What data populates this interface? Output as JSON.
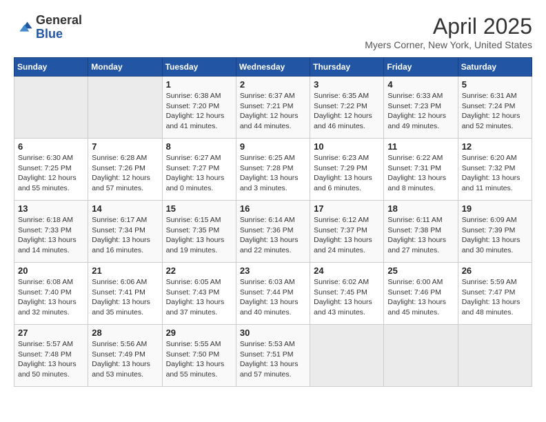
{
  "header": {
    "logo_general": "General",
    "logo_blue": "Blue",
    "month_title": "April 2025",
    "location": "Myers Corner, New York, United States"
  },
  "weekdays": [
    "Sunday",
    "Monday",
    "Tuesday",
    "Wednesday",
    "Thursday",
    "Friday",
    "Saturday"
  ],
  "weeks": [
    [
      {
        "day": "",
        "info": ""
      },
      {
        "day": "",
        "info": ""
      },
      {
        "day": "1",
        "sunrise": "6:38 AM",
        "sunset": "7:20 PM",
        "daylight": "12 hours and 41 minutes."
      },
      {
        "day": "2",
        "sunrise": "6:37 AM",
        "sunset": "7:21 PM",
        "daylight": "12 hours and 44 minutes."
      },
      {
        "day": "3",
        "sunrise": "6:35 AM",
        "sunset": "7:22 PM",
        "daylight": "12 hours and 46 minutes."
      },
      {
        "day": "4",
        "sunrise": "6:33 AM",
        "sunset": "7:23 PM",
        "daylight": "12 hours and 49 minutes."
      },
      {
        "day": "5",
        "sunrise": "6:31 AM",
        "sunset": "7:24 PM",
        "daylight": "12 hours and 52 minutes."
      }
    ],
    [
      {
        "day": "6",
        "sunrise": "6:30 AM",
        "sunset": "7:25 PM",
        "daylight": "12 hours and 55 minutes."
      },
      {
        "day": "7",
        "sunrise": "6:28 AM",
        "sunset": "7:26 PM",
        "daylight": "12 hours and 57 minutes."
      },
      {
        "day": "8",
        "sunrise": "6:27 AM",
        "sunset": "7:27 PM",
        "daylight": "13 hours and 0 minutes."
      },
      {
        "day": "9",
        "sunrise": "6:25 AM",
        "sunset": "7:28 PM",
        "daylight": "13 hours and 3 minutes."
      },
      {
        "day": "10",
        "sunrise": "6:23 AM",
        "sunset": "7:29 PM",
        "daylight": "13 hours and 6 minutes."
      },
      {
        "day": "11",
        "sunrise": "6:22 AM",
        "sunset": "7:31 PM",
        "daylight": "13 hours and 8 minutes."
      },
      {
        "day": "12",
        "sunrise": "6:20 AM",
        "sunset": "7:32 PM",
        "daylight": "13 hours and 11 minutes."
      }
    ],
    [
      {
        "day": "13",
        "sunrise": "6:18 AM",
        "sunset": "7:33 PM",
        "daylight": "13 hours and 14 minutes."
      },
      {
        "day": "14",
        "sunrise": "6:17 AM",
        "sunset": "7:34 PM",
        "daylight": "13 hours and 16 minutes."
      },
      {
        "day": "15",
        "sunrise": "6:15 AM",
        "sunset": "7:35 PM",
        "daylight": "13 hours and 19 minutes."
      },
      {
        "day": "16",
        "sunrise": "6:14 AM",
        "sunset": "7:36 PM",
        "daylight": "13 hours and 22 minutes."
      },
      {
        "day": "17",
        "sunrise": "6:12 AM",
        "sunset": "7:37 PM",
        "daylight": "13 hours and 24 minutes."
      },
      {
        "day": "18",
        "sunrise": "6:11 AM",
        "sunset": "7:38 PM",
        "daylight": "13 hours and 27 minutes."
      },
      {
        "day": "19",
        "sunrise": "6:09 AM",
        "sunset": "7:39 PM",
        "daylight": "13 hours and 30 minutes."
      }
    ],
    [
      {
        "day": "20",
        "sunrise": "6:08 AM",
        "sunset": "7:40 PM",
        "daylight": "13 hours and 32 minutes."
      },
      {
        "day": "21",
        "sunrise": "6:06 AM",
        "sunset": "7:41 PM",
        "daylight": "13 hours and 35 minutes."
      },
      {
        "day": "22",
        "sunrise": "6:05 AM",
        "sunset": "7:43 PM",
        "daylight": "13 hours and 37 minutes."
      },
      {
        "day": "23",
        "sunrise": "6:03 AM",
        "sunset": "7:44 PM",
        "daylight": "13 hours and 40 minutes."
      },
      {
        "day": "24",
        "sunrise": "6:02 AM",
        "sunset": "7:45 PM",
        "daylight": "13 hours and 43 minutes."
      },
      {
        "day": "25",
        "sunrise": "6:00 AM",
        "sunset": "7:46 PM",
        "daylight": "13 hours and 45 minutes."
      },
      {
        "day": "26",
        "sunrise": "5:59 AM",
        "sunset": "7:47 PM",
        "daylight": "13 hours and 48 minutes."
      }
    ],
    [
      {
        "day": "27",
        "sunrise": "5:57 AM",
        "sunset": "7:48 PM",
        "daylight": "13 hours and 50 minutes."
      },
      {
        "day": "28",
        "sunrise": "5:56 AM",
        "sunset": "7:49 PM",
        "daylight": "13 hours and 53 minutes."
      },
      {
        "day": "29",
        "sunrise": "5:55 AM",
        "sunset": "7:50 PM",
        "daylight": "13 hours and 55 minutes."
      },
      {
        "day": "30",
        "sunrise": "5:53 AM",
        "sunset": "7:51 PM",
        "daylight": "13 hours and 57 minutes."
      },
      {
        "day": "",
        "info": ""
      },
      {
        "day": "",
        "info": ""
      },
      {
        "day": "",
        "info": ""
      }
    ]
  ]
}
